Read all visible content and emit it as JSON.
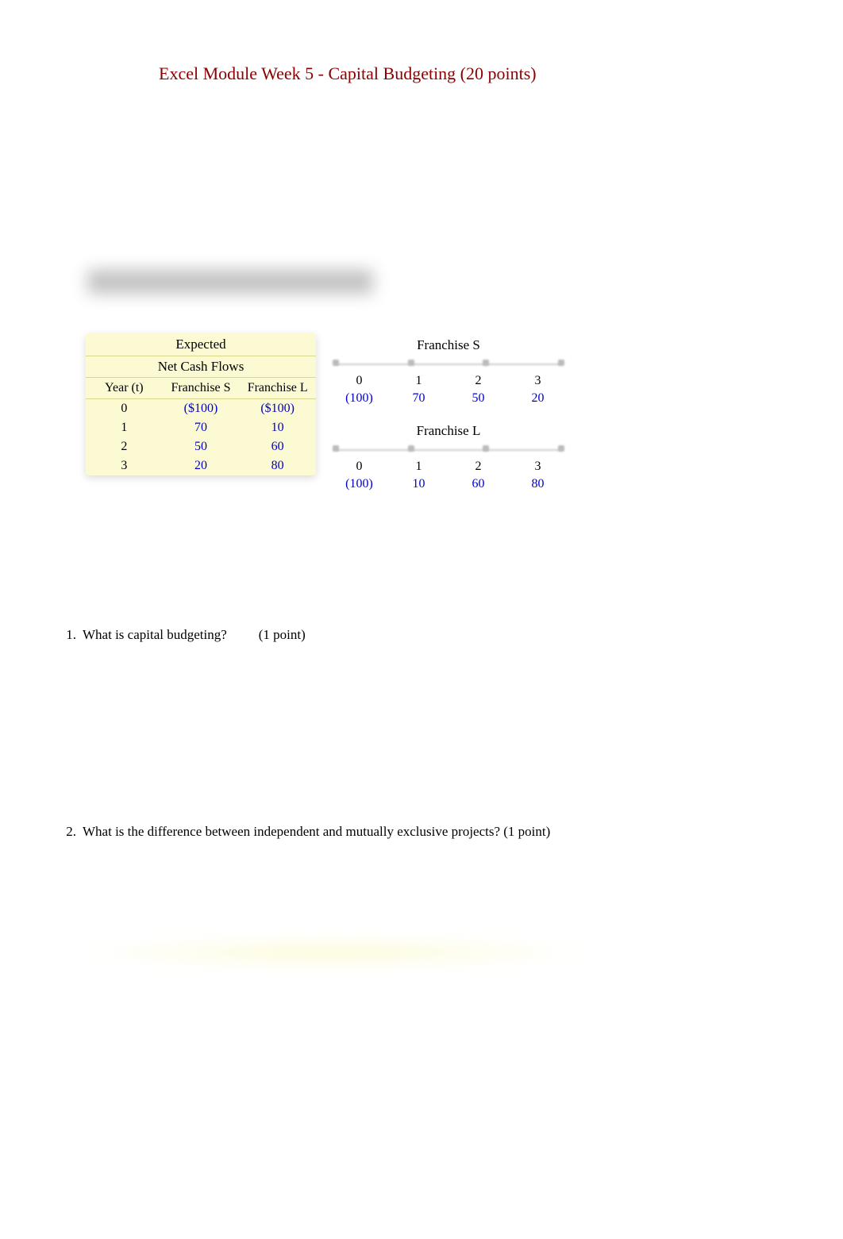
{
  "title": "Excel Module Week 5 - Capital Budgeting (20 points)",
  "blurred_heading": "Here are the net cash flows (in thousands of dollars):",
  "expected_table": {
    "header_line1": "Expected",
    "header_line2": "Net Cash Flows",
    "columns": {
      "year": "Year (t)",
      "s": "Franchise S",
      "l": "Franchise L"
    },
    "rows": [
      {
        "year": "0",
        "s": "($100)",
        "l": "($100)"
      },
      {
        "year": "1",
        "s": "70",
        "l": "10"
      },
      {
        "year": "2",
        "s": "50",
        "l": "60"
      },
      {
        "year": "3",
        "s": "20",
        "l": "80"
      }
    ]
  },
  "franchise_s": {
    "title": "Franchise S",
    "periods": [
      "0",
      "1",
      "2",
      "3"
    ],
    "values": [
      "(100)",
      "70",
      "50",
      "20"
    ]
  },
  "franchise_l": {
    "title": "Franchise L",
    "periods": [
      "0",
      "1",
      "2",
      "3"
    ],
    "values": [
      "(100)",
      "10",
      "60",
      "80"
    ]
  },
  "questions": {
    "q1": {
      "num": "1.",
      "text": "What is capital budgeting?",
      "points": "(1 point)"
    },
    "q2": {
      "num": "2.",
      "text": "What is the difference between independent and mutually exclusive projects? (1 point)"
    }
  },
  "chart_data": [
    {
      "type": "table",
      "title": "Expected Net Cash Flows",
      "columns": [
        "Year (t)",
        "Franchise S",
        "Franchise L"
      ],
      "rows": [
        [
          0,
          -100,
          -100
        ],
        [
          1,
          70,
          10
        ],
        [
          2,
          50,
          60
        ],
        [
          3,
          20,
          80
        ]
      ]
    },
    {
      "type": "table",
      "title": "Franchise S",
      "columns": [
        "0",
        "1",
        "2",
        "3"
      ],
      "rows": [
        [
          -100,
          70,
          50,
          20
        ]
      ]
    },
    {
      "type": "table",
      "title": "Franchise L",
      "columns": [
        "0",
        "1",
        "2",
        "3"
      ],
      "rows": [
        [
          -100,
          10,
          60,
          80
        ]
      ]
    }
  ]
}
